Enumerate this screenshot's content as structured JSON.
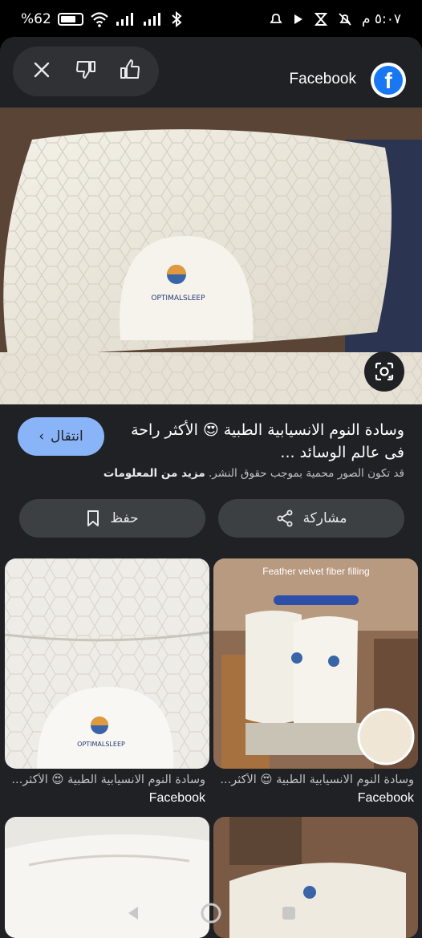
{
  "status_bar": {
    "battery": "%62",
    "time": "٥:٠٧ م"
  },
  "header": {
    "source_name": "Facebook",
    "logo_letter": "f"
  },
  "result": {
    "visit_label": "انتقال",
    "title": "وسادة النوم الانسيابية الطبية 😍 الأكثر راحة فى عالم الوسائد ...",
    "copyright_text": "قد تكون الصور محمية بموجب حقوق النشر.",
    "more_info_label": "مزيد من المعلومات"
  },
  "actions": {
    "share_label": "مشاركة",
    "save_label": "حفظ"
  },
  "main_image": {
    "logo_text": "OPTIMALSLEEP"
  },
  "related": [
    {
      "caption": "وسادة النوم الانسيابية الطبية 😍 الأكثر...",
      "source": "Facebook",
      "logo_text": "OPTIMALSLEEP"
    },
    {
      "caption": "وسادة النوم الانسيابية الطبية 😍 الأكثر...",
      "source": "Facebook",
      "banner_text": "Feather velvet fiber filling"
    }
  ],
  "colors": {
    "sheet_background": "#202124",
    "accent_button": "#8ab4f8",
    "pill_button": "#3c4043",
    "facebook_blue": "#1877f2"
  }
}
